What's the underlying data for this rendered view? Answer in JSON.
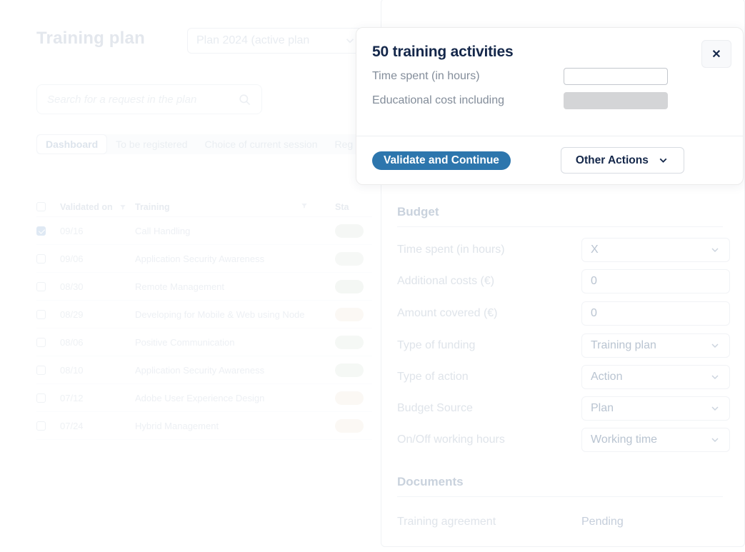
{
  "header": {
    "title": "Training plan",
    "plan_select_value": "Plan 2024 (active plan",
    "plan_select_icon": "chevron-down-icon"
  },
  "search": {
    "placeholder": "Search for a request in the plan",
    "icon": "search-icon"
  },
  "tabs": [
    {
      "label": "Dashboard",
      "active": true
    },
    {
      "label": "To be registered",
      "active": false
    },
    {
      "label": "Choice of current session",
      "active": false
    },
    {
      "label": "Reg",
      "active": false
    }
  ],
  "table": {
    "columns": [
      "Validated on",
      "Training",
      "Sta"
    ],
    "rows": [
      {
        "checked": true,
        "date": "09/16",
        "training": "Call Handling",
        "status_color": "#f5f7f5"
      },
      {
        "checked": false,
        "date": "09/06",
        "training": "Application Security Awareness",
        "status_color": "#f6f8f6"
      },
      {
        "checked": false,
        "date": "08/30",
        "training": "Remote Management",
        "status_color": "#f4f7f4"
      },
      {
        "checked": false,
        "date": "08/29",
        "training": "Developing for Mobile & Web using Node",
        "status_color": "#fbf8f4"
      },
      {
        "checked": false,
        "date": "08/06",
        "training": "Positive Communication",
        "status_color": "#f5f8f5"
      },
      {
        "checked": false,
        "date": "08/10",
        "training": "Application Security Awareness",
        "status_color": "#f5f8f5"
      },
      {
        "checked": false,
        "date": "07/12",
        "training": "Adobe User Experience Design",
        "status_color": "#fbf8f4"
      },
      {
        "checked": false,
        "date": "07/24",
        "training": "Hybrid Management",
        "status_color": "#fbf8f4"
      }
    ]
  },
  "detail": {
    "budget_section": "Budget",
    "budget_fields": [
      {
        "label": "Time spent (in hours)",
        "value": "X",
        "type": "select"
      },
      {
        "label": "Additional costs (€)",
        "value": "0",
        "type": "input"
      },
      {
        "label": "Amount covered (€)",
        "value": "0",
        "type": "input"
      },
      {
        "label": "Type of funding",
        "value": "Training plan",
        "type": "select"
      },
      {
        "label": "Type of action",
        "value": "Action",
        "type": "select"
      },
      {
        "label": "Budget Source",
        "value": "Plan",
        "type": "select"
      },
      {
        "label": "On/Off working hours",
        "value": "Working time",
        "type": "select"
      }
    ],
    "documents_section": "Documents",
    "documents": [
      {
        "label": "Training agreement",
        "value": "Pending"
      }
    ]
  },
  "modal": {
    "title": "50 training activities",
    "close_icon": "close-icon",
    "fields": [
      {
        "label": "Time spent (in hours)",
        "value": "",
        "disabled": false
      },
      {
        "label": "Educational cost including",
        "value": "",
        "disabled": true
      }
    ],
    "primary_button": "Validate and Continue",
    "secondary_button": "Other Actions",
    "secondary_icon": "chevron-down-icon"
  },
  "colors": {
    "accent": "#2d76ad",
    "modal_title": "#14274a",
    "muted_text": "#838d9a"
  }
}
